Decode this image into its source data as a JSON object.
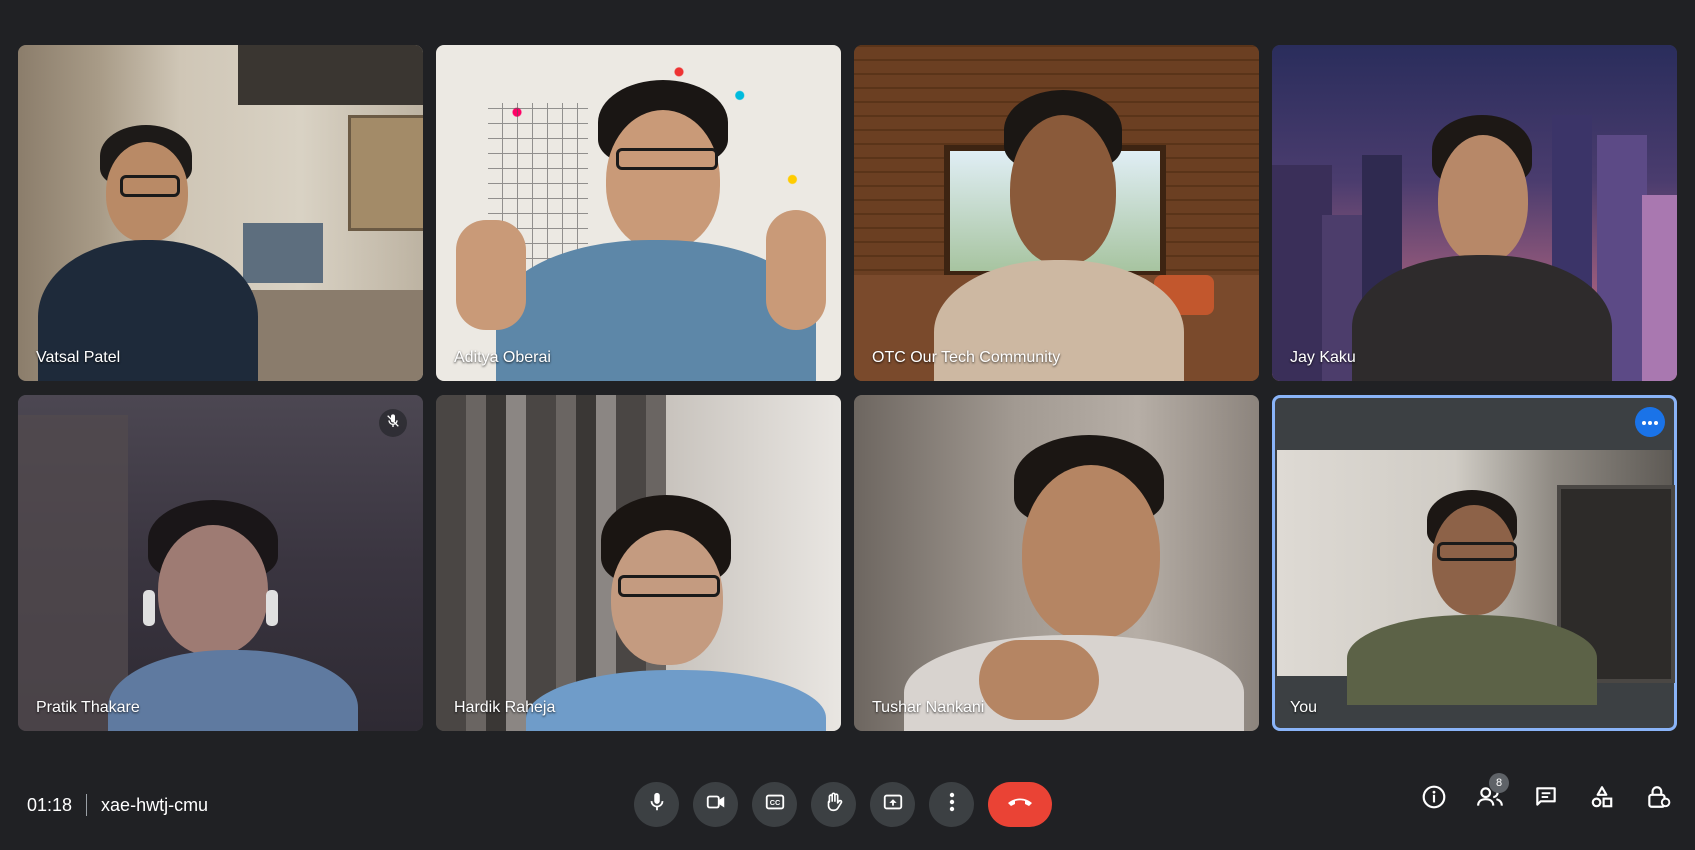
{
  "participants": [
    {
      "name": "Vatsal Patel"
    },
    {
      "name": "Aditya Oberai"
    },
    {
      "name": "OTC Our Tech Community"
    },
    {
      "name": "Jay Kaku"
    },
    {
      "name": "Pratik Thakare",
      "muted": true
    },
    {
      "name": "Hardik Raheja"
    },
    {
      "name": "Tushar Nankani"
    },
    {
      "name": "You",
      "self": true
    }
  ],
  "meeting": {
    "time": "01:18",
    "code": "xae-hwtj-cmu"
  },
  "controls": {
    "icons": [
      "microphone-icon",
      "camera-icon",
      "captions-icon",
      "raise-hand-icon",
      "present-icon",
      "more-options-icon",
      "end-call-icon"
    ]
  },
  "sidepanel": {
    "people_count": "8",
    "icons": [
      "info-icon",
      "people-icon",
      "chat-icon",
      "activities-icon",
      "host-controls-icon"
    ]
  },
  "colors": {
    "background": "#202124",
    "tile": "#3c4043",
    "accent": "#1a73e8",
    "end_call": "#ea4335",
    "self_border": "#8ab4f8"
  }
}
